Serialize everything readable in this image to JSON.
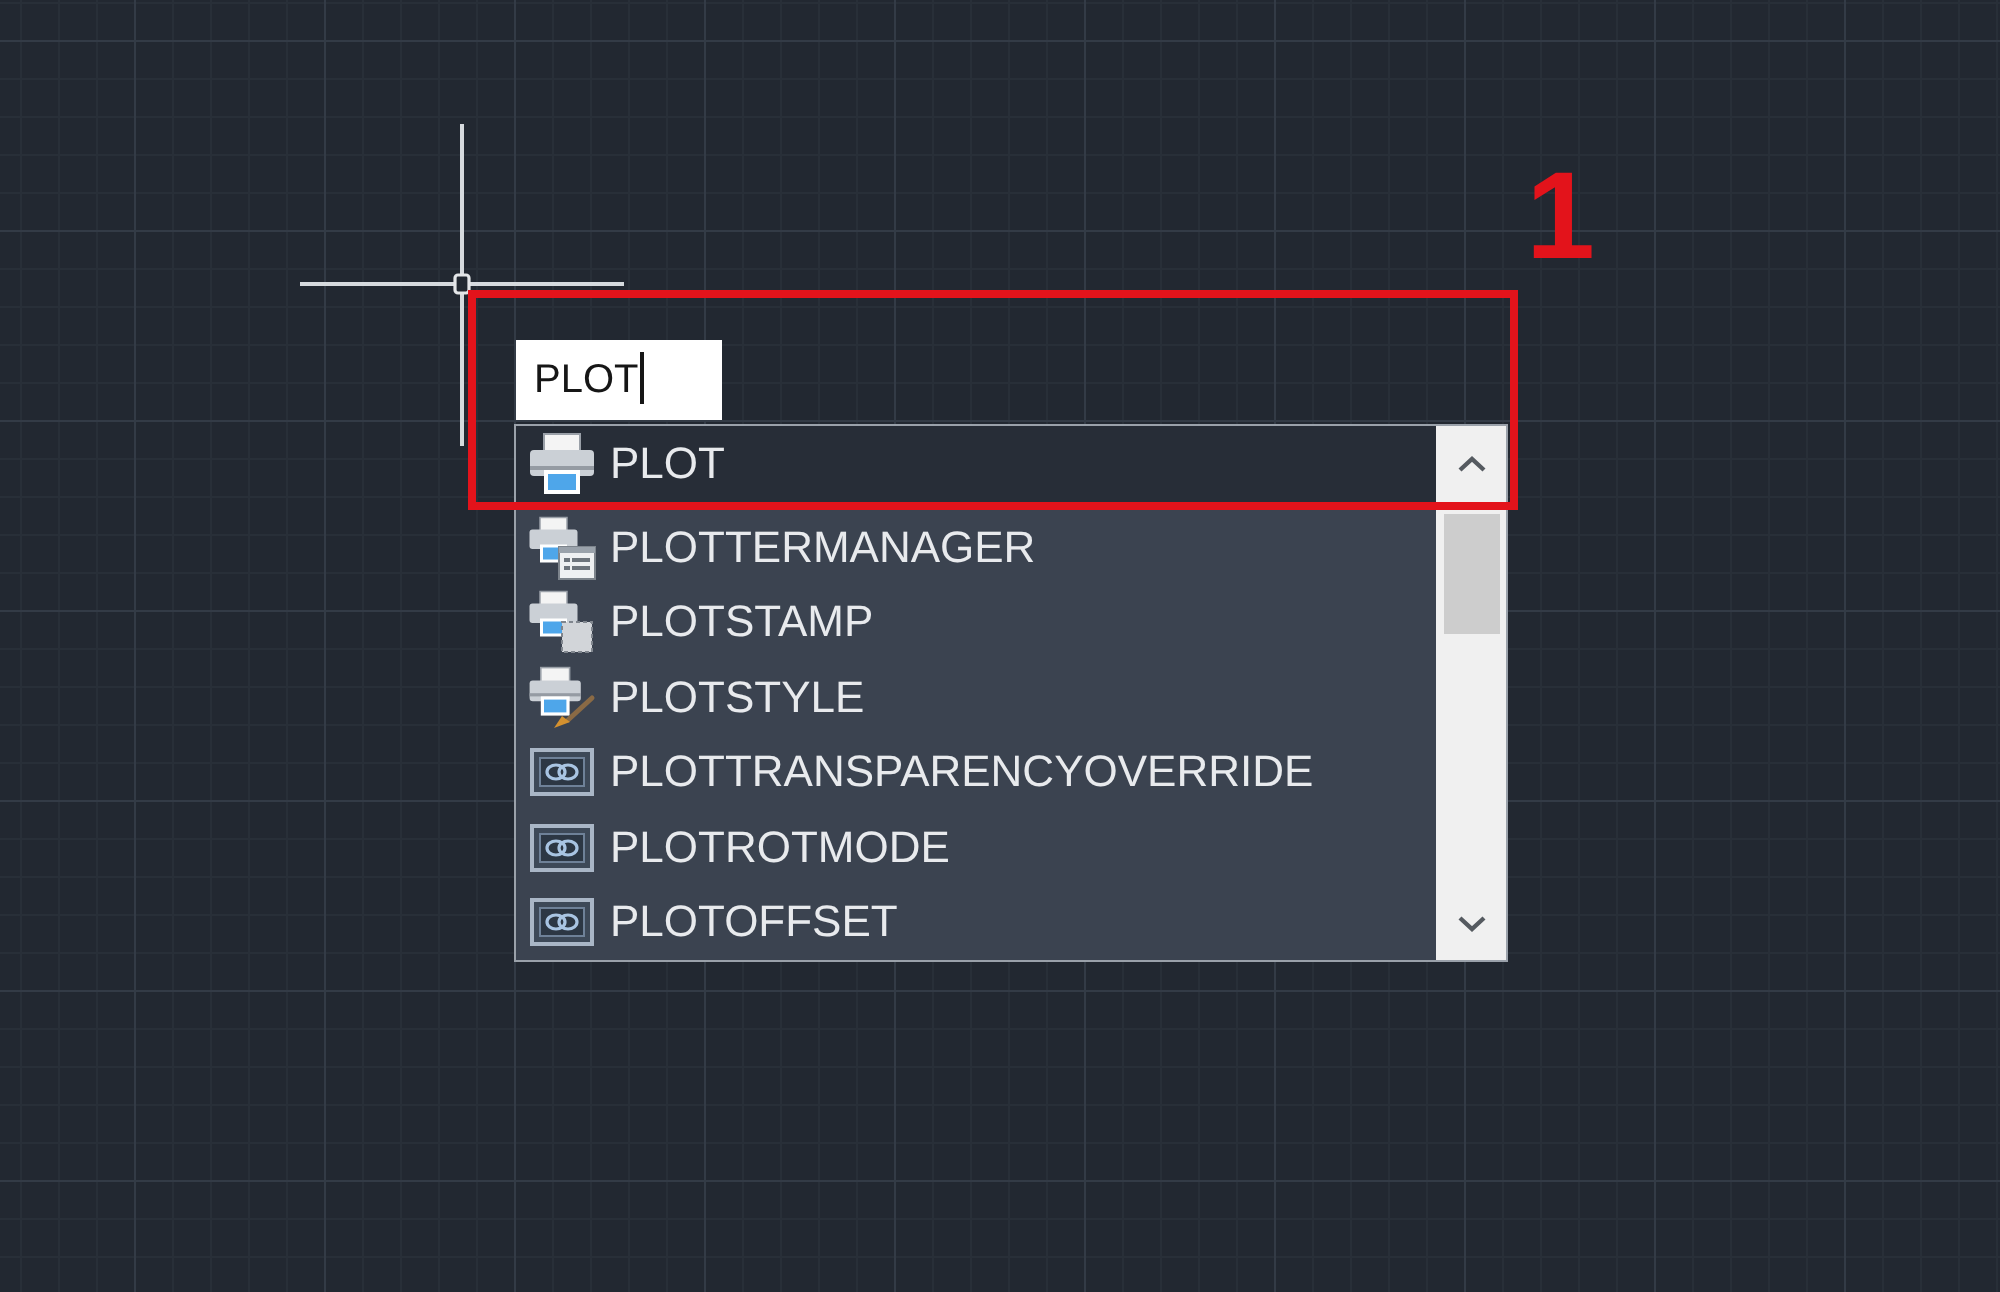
{
  "command_input": {
    "value": "PLOT"
  },
  "suggestions": [
    {
      "label": "PLOT",
      "kind": "print",
      "selected": true
    },
    {
      "label": "PLOTTERMANAGER",
      "kind": "manager",
      "selected": false
    },
    {
      "label": "PLOTSTAMP",
      "kind": "stamp",
      "selected": false
    },
    {
      "label": "PLOTSTYLE",
      "kind": "style",
      "selected": false
    },
    {
      "label": "PLOTTRANSPARENCYOVERRIDE",
      "kind": "variable",
      "selected": false
    },
    {
      "label": "PLOTROTMODE",
      "kind": "variable",
      "selected": false
    },
    {
      "label": "PLOTOFFSET",
      "kind": "variable",
      "selected": false
    }
  ],
  "annotation": {
    "label": "1"
  }
}
